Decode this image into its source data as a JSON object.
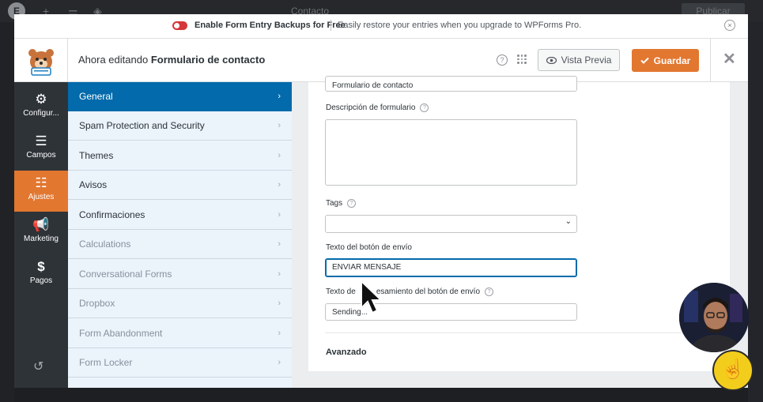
{
  "background": {
    "page_title": "Contacto",
    "publish_label": "Publicar"
  },
  "notice": {
    "strong_text": "Enable Form Entry Backups for Free",
    "text": "Easily restore your entries when you upgrade to WPForms Pro."
  },
  "header": {
    "editing_prefix": "Ahora editando",
    "form_name": "Formulario de contacto",
    "preview_label": "Vista Previa",
    "save_label": "Guardar"
  },
  "rail": {
    "items": [
      {
        "label": "Configur...",
        "icon": "gear-icon"
      },
      {
        "label": "Campos",
        "icon": "fields-icon"
      },
      {
        "label": "Ajustes",
        "icon": "sliders-icon"
      },
      {
        "label": "Marketing",
        "icon": "megaphone-icon"
      },
      {
        "label": "Pagos",
        "icon": "dollar-icon"
      }
    ]
  },
  "submenu": {
    "items": [
      {
        "label": "General"
      },
      {
        "label": "Spam Protection and Security"
      },
      {
        "label": "Themes"
      },
      {
        "label": "Avisos"
      },
      {
        "label": "Confirmaciones"
      },
      {
        "label": "Calculations"
      },
      {
        "label": "Conversational Forms"
      },
      {
        "label": "Dropbox"
      },
      {
        "label": "Form Abandonment"
      },
      {
        "label": "Form Locker"
      }
    ]
  },
  "form": {
    "form_name_value": "Formulario de contacto",
    "description_label": "Descripción de formulario",
    "description_value": "",
    "tags_label": "Tags",
    "tags_value": "",
    "submit_text_label": "Texto del botón de envío",
    "submit_text_value": "ENVIAR MENSAJE",
    "processing_label_part1": "Texto de",
    "processing_label_part2": "esamiento del botón de envío",
    "processing_value": "Sending...",
    "advanced_title": "Avanzado"
  },
  "colors": {
    "accent_orange": "#e27730",
    "active_blue": "#036aab",
    "rail_bg": "#2e3338",
    "submenu_bg": "#ebf3fb"
  }
}
